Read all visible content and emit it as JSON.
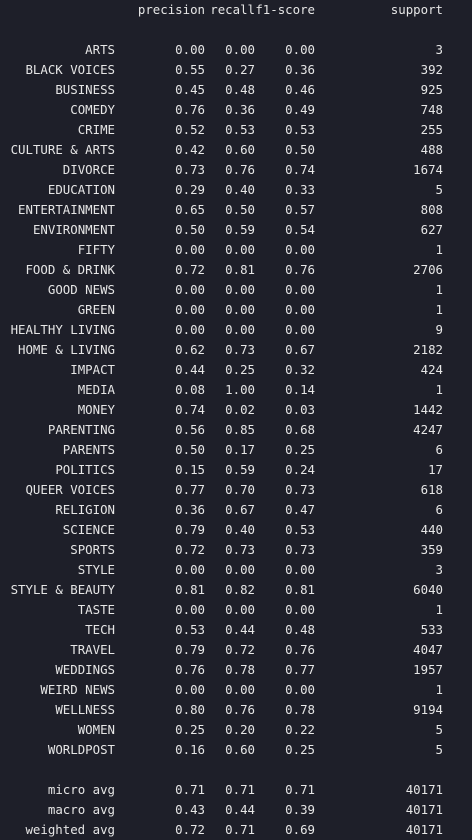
{
  "report": {
    "headers": {
      "precision": "precision",
      "recall": "recall",
      "f1": "f1-score",
      "support": "support"
    },
    "rows": [
      {
        "label": "ARTS",
        "precision": "0.00",
        "recall": "0.00",
        "f1": "0.00",
        "support": "3"
      },
      {
        "label": "BLACK VOICES",
        "precision": "0.55",
        "recall": "0.27",
        "f1": "0.36",
        "support": "392"
      },
      {
        "label": "BUSINESS",
        "precision": "0.45",
        "recall": "0.48",
        "f1": "0.46",
        "support": "925"
      },
      {
        "label": "COMEDY",
        "precision": "0.76",
        "recall": "0.36",
        "f1": "0.49",
        "support": "748"
      },
      {
        "label": "CRIME",
        "precision": "0.52",
        "recall": "0.53",
        "f1": "0.53",
        "support": "255"
      },
      {
        "label": "CULTURE & ARTS",
        "precision": "0.42",
        "recall": "0.60",
        "f1": "0.50",
        "support": "488"
      },
      {
        "label": "DIVORCE",
        "precision": "0.73",
        "recall": "0.76",
        "f1": "0.74",
        "support": "1674"
      },
      {
        "label": "EDUCATION",
        "precision": "0.29",
        "recall": "0.40",
        "f1": "0.33",
        "support": "5"
      },
      {
        "label": "ENTERTAINMENT",
        "precision": "0.65",
        "recall": "0.50",
        "f1": "0.57",
        "support": "808"
      },
      {
        "label": "ENVIRONMENT",
        "precision": "0.50",
        "recall": "0.59",
        "f1": "0.54",
        "support": "627"
      },
      {
        "label": "FIFTY",
        "precision": "0.00",
        "recall": "0.00",
        "f1": "0.00",
        "support": "1"
      },
      {
        "label": "FOOD & DRINK",
        "precision": "0.72",
        "recall": "0.81",
        "f1": "0.76",
        "support": "2706"
      },
      {
        "label": "GOOD NEWS",
        "precision": "0.00",
        "recall": "0.00",
        "f1": "0.00",
        "support": "1"
      },
      {
        "label": "GREEN",
        "precision": "0.00",
        "recall": "0.00",
        "f1": "0.00",
        "support": "1"
      },
      {
        "label": "HEALTHY LIVING",
        "precision": "0.00",
        "recall": "0.00",
        "f1": "0.00",
        "support": "9"
      },
      {
        "label": "HOME & LIVING",
        "precision": "0.62",
        "recall": "0.73",
        "f1": "0.67",
        "support": "2182"
      },
      {
        "label": "IMPACT",
        "precision": "0.44",
        "recall": "0.25",
        "f1": "0.32",
        "support": "424"
      },
      {
        "label": "MEDIA",
        "precision": "0.08",
        "recall": "1.00",
        "f1": "0.14",
        "support": "1"
      },
      {
        "label": "MONEY",
        "precision": "0.74",
        "recall": "0.02",
        "f1": "0.03",
        "support": "1442"
      },
      {
        "label": "PARENTING",
        "precision": "0.56",
        "recall": "0.85",
        "f1": "0.68",
        "support": "4247"
      },
      {
        "label": "PARENTS",
        "precision": "0.50",
        "recall": "0.17",
        "f1": "0.25",
        "support": "6"
      },
      {
        "label": "POLITICS",
        "precision": "0.15",
        "recall": "0.59",
        "f1": "0.24",
        "support": "17"
      },
      {
        "label": "QUEER VOICES",
        "precision": "0.77",
        "recall": "0.70",
        "f1": "0.73",
        "support": "618"
      },
      {
        "label": "RELIGION",
        "precision": "0.36",
        "recall": "0.67",
        "f1": "0.47",
        "support": "6"
      },
      {
        "label": "SCIENCE",
        "precision": "0.79",
        "recall": "0.40",
        "f1": "0.53",
        "support": "440"
      },
      {
        "label": "SPORTS",
        "precision": "0.72",
        "recall": "0.73",
        "f1": "0.73",
        "support": "359"
      },
      {
        "label": "STYLE",
        "precision": "0.00",
        "recall": "0.00",
        "f1": "0.00",
        "support": "3"
      },
      {
        "label": "STYLE & BEAUTY",
        "precision": "0.81",
        "recall": "0.82",
        "f1": "0.81",
        "support": "6040"
      },
      {
        "label": "TASTE",
        "precision": "0.00",
        "recall": "0.00",
        "f1": "0.00",
        "support": "1"
      },
      {
        "label": "TECH",
        "precision": "0.53",
        "recall": "0.44",
        "f1": "0.48",
        "support": "533"
      },
      {
        "label": "TRAVEL",
        "precision": "0.79",
        "recall": "0.72",
        "f1": "0.76",
        "support": "4047"
      },
      {
        "label": "WEDDINGS",
        "precision": "0.76",
        "recall": "0.78",
        "f1": "0.77",
        "support": "1957"
      },
      {
        "label": "WEIRD NEWS",
        "precision": "0.00",
        "recall": "0.00",
        "f1": "0.00",
        "support": "1"
      },
      {
        "label": "WELLNESS",
        "precision": "0.80",
        "recall": "0.76",
        "f1": "0.78",
        "support": "9194"
      },
      {
        "label": "WOMEN",
        "precision": "0.25",
        "recall": "0.20",
        "f1": "0.22",
        "support": "5"
      },
      {
        "label": "WORLDPOST",
        "precision": "0.16",
        "recall": "0.60",
        "f1": "0.25",
        "support": "5"
      }
    ],
    "averages": [
      {
        "label": "micro avg",
        "precision": "0.71",
        "recall": "0.71",
        "f1": "0.71",
        "support": "40171"
      },
      {
        "label": "macro avg",
        "precision": "0.43",
        "recall": "0.44",
        "f1": "0.39",
        "support": "40171"
      },
      {
        "label": "weighted avg",
        "precision": "0.72",
        "recall": "0.71",
        "f1": "0.69",
        "support": "40171"
      }
    ]
  }
}
